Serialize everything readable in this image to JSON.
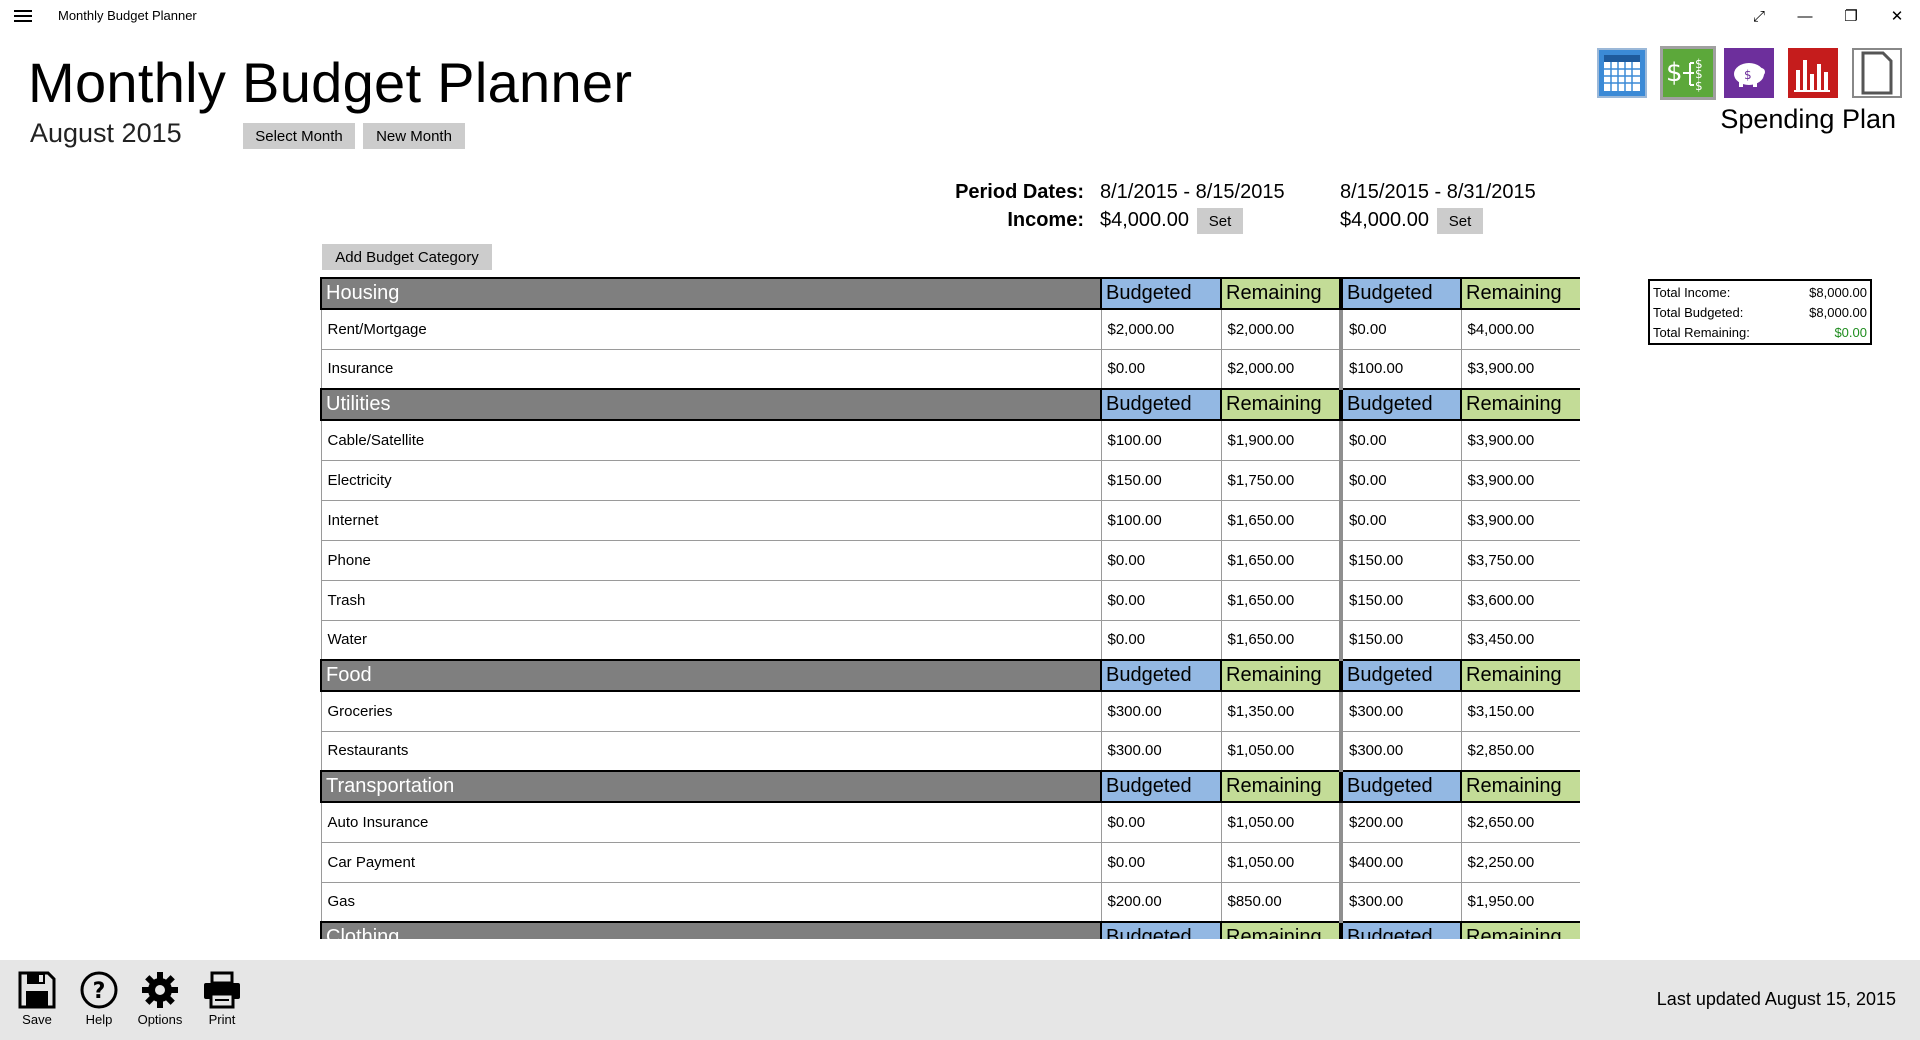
{
  "window": {
    "title": "Monthly Budget Planner"
  },
  "header": {
    "title": "Monthly Budget Planner",
    "month": "August 2015",
    "select_month": "Select Month",
    "new_month": "New Month",
    "view_caption": "Spending Plan"
  },
  "periods": {
    "period_label": "Period Dates:",
    "income_label": "Income:",
    "p1_dates": "8/1/2015 - 8/15/2015",
    "p2_dates": "8/15/2015 - 8/31/2015",
    "p1_income": "$4,000.00",
    "p2_income": "$4,000.00",
    "set_label": "Set"
  },
  "add_category_label": "Add Budget Category",
  "column_labels": {
    "budgeted": "Budgeted",
    "remaining": "Remaining"
  },
  "categories": [
    {
      "name": "Housing",
      "items": [
        {
          "name": "Rent/Mortgage",
          "b1": "$2,000.00",
          "r1": "$2,000.00",
          "b2": "$0.00",
          "r2": "$4,000.00"
        },
        {
          "name": "Insurance",
          "b1": "$0.00",
          "r1": "$2,000.00",
          "b2": "$100.00",
          "r2": "$3,900.00"
        }
      ]
    },
    {
      "name": "Utilities",
      "items": [
        {
          "name": "Cable/Satellite",
          "b1": "$100.00",
          "r1": "$1,900.00",
          "b2": "$0.00",
          "r2": "$3,900.00"
        },
        {
          "name": "Electricity",
          "b1": "$150.00",
          "r1": "$1,750.00",
          "b2": "$0.00",
          "r2": "$3,900.00"
        },
        {
          "name": "Internet",
          "b1": "$100.00",
          "r1": "$1,650.00",
          "b2": "$0.00",
          "r2": "$3,900.00"
        },
        {
          "name": "Phone",
          "b1": "$0.00",
          "r1": "$1,650.00",
          "b2": "$150.00",
          "r2": "$3,750.00"
        },
        {
          "name": "Trash",
          "b1": "$0.00",
          "r1": "$1,650.00",
          "b2": "$150.00",
          "r2": "$3,600.00"
        },
        {
          "name": "Water",
          "b1": "$0.00",
          "r1": "$1,650.00",
          "b2": "$150.00",
          "r2": "$3,450.00"
        }
      ]
    },
    {
      "name": "Food",
      "items": [
        {
          "name": "Groceries",
          "b1": "$300.00",
          "r1": "$1,350.00",
          "b2": "$300.00",
          "r2": "$3,150.00"
        },
        {
          "name": "Restaurants",
          "b1": "$300.00",
          "r1": "$1,050.00",
          "b2": "$300.00",
          "r2": "$2,850.00"
        }
      ]
    },
    {
      "name": "Transportation",
      "items": [
        {
          "name": "Auto Insurance",
          "b1": "$0.00",
          "r1": "$1,050.00",
          "b2": "$200.00",
          "r2": "$2,650.00"
        },
        {
          "name": "Car Payment",
          "b1": "$0.00",
          "r1": "$1,050.00",
          "b2": "$400.00",
          "r2": "$2,250.00"
        },
        {
          "name": "Gas",
          "b1": "$200.00",
          "r1": "$850.00",
          "b2": "$300.00",
          "r2": "$1,950.00"
        }
      ]
    },
    {
      "name": "Clothing",
      "items": []
    }
  ],
  "totals": {
    "income_label": "Total Income:",
    "income": "$8,000.00",
    "budgeted_label": "Total Budgeted:",
    "budgeted": "$8,000.00",
    "remaining_label": "Total Remaining:",
    "remaining": "$0.00"
  },
  "toolbar": {
    "save": "Save",
    "help": "Help",
    "options": "Options",
    "print": "Print"
  },
  "status": {
    "last_updated": "Last updated August 15, 2015"
  },
  "colors": {
    "budgeted_header": "#93b8e3",
    "remaining_header": "#c3dc97",
    "category_header": "#7f7f7f",
    "total_remaining": "#1e8c1e"
  }
}
